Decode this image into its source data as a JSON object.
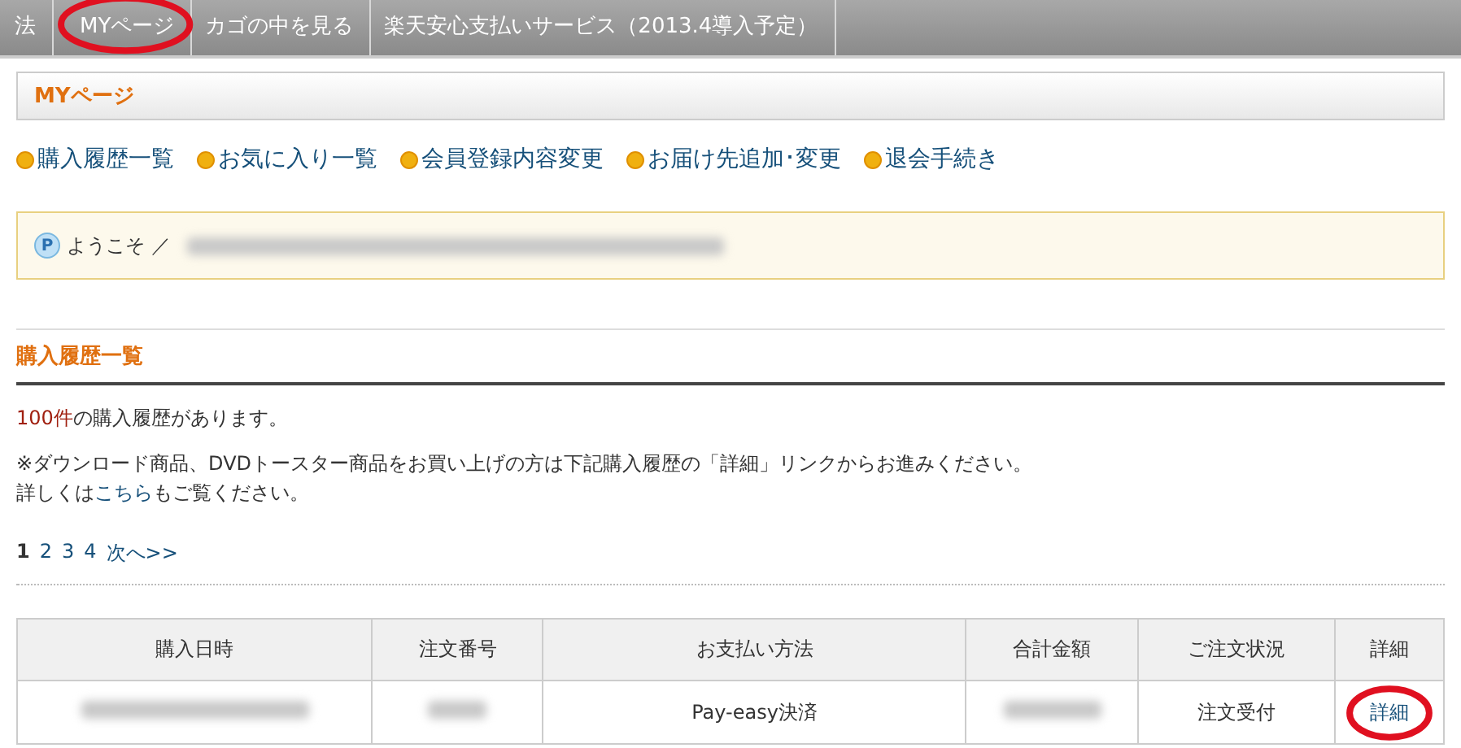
{
  "nav_tabs": [
    {
      "label": "法",
      "highlighted": false
    },
    {
      "label": "MYページ",
      "highlighted": true
    },
    {
      "label": "カゴの中を見る",
      "highlighted": false
    },
    {
      "label": "楽天安心支払いサービス（2013.4導入予定）",
      "highlighted": false
    }
  ],
  "panel_title": "MYページ",
  "menu_links": [
    "購入履歴一覧",
    "お気に入り一覧",
    "会員登録内容変更",
    "お届け先追加･変更",
    "退会手続き"
  ],
  "welcome": {
    "icon_letter": "P",
    "greeting": "ようこそ ／",
    "name_redacted": true
  },
  "section_title": "購入履歴一覧",
  "count_text": "**100件**の購入履歴があります。",
  "notes": [
    {
      "text": "※ダウンロード商品、DVDトースター商品をお買い上げの方は下記購入履歴の「詳細」リンクからお進みください。"
    },
    {
      "before": "詳しくは",
      "link": "こちら",
      "after": "もご覧ください。"
    }
  ],
  "pagination": [
    {
      "label": "1",
      "selected": true
    },
    {
      "label": "2",
      "selected": false
    },
    {
      "label": "3",
      "selected": false
    },
    {
      "label": "4",
      "selected": false
    },
    {
      "label": "次へ>>",
      "selected": false
    }
  ],
  "table": {
    "columns": [
      "購入日時",
      "注文番号",
      "お支払い方法",
      "合計金額",
      "ご注文状況",
      "詳細"
    ],
    "rows": [
      {
        "cells": [
          {
            "kind": "redacted"
          },
          {
            "kind": "redacted"
          },
          {
            "kind": "text",
            "text": "Pay-easy決済"
          },
          {
            "kind": "redacted"
          },
          {
            "kind": "text",
            "text": "注文受付"
          },
          {
            "kind": "link",
            "text": "詳細",
            "highlighted": true
          }
        ]
      }
    ]
  }
}
